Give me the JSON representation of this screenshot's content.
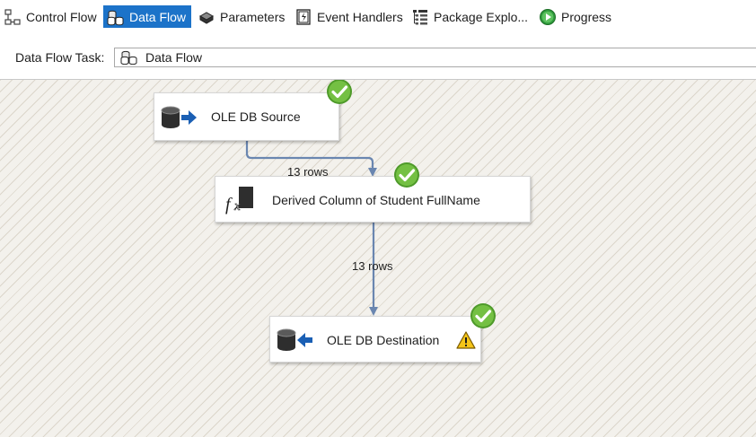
{
  "tabs": [
    {
      "label": "Control Flow",
      "icon": "control-flow-icon",
      "active": false
    },
    {
      "label": "Data Flow",
      "icon": "data-flow-icon",
      "active": true
    },
    {
      "label": "Parameters",
      "icon": "parameters-icon",
      "active": false
    },
    {
      "label": "Event Handlers",
      "icon": "event-handlers-icon",
      "active": false
    },
    {
      "label": "Package Explo...",
      "icon": "package-explorer-icon",
      "active": false
    },
    {
      "label": "Progress",
      "icon": "progress-play-icon",
      "active": false
    }
  ],
  "task": {
    "label": "Data Flow Task:",
    "selected": "Data Flow",
    "selected_icon": "data-flow-icon"
  },
  "components": [
    {
      "name": "OLE DB Source",
      "icon": "ole-db-source-icon",
      "status": "success",
      "warning": false
    },
    {
      "name": "Derived Column of Student FullName",
      "icon": "derived-column-icon",
      "status": "success",
      "warning": false
    },
    {
      "name": "OLE DB Destination",
      "icon": "ole-db-destination-icon",
      "status": "success",
      "warning": true
    }
  ],
  "paths": [
    {
      "rows_label": "13 rows"
    },
    {
      "rows_label": "13 rows"
    }
  ],
  "colors": {
    "tab_active": "#1c73c9",
    "path_line": "#6a86b0",
    "success": "#6cb43a",
    "warning": "#f5c518",
    "canvas": "#f3f1ec"
  }
}
